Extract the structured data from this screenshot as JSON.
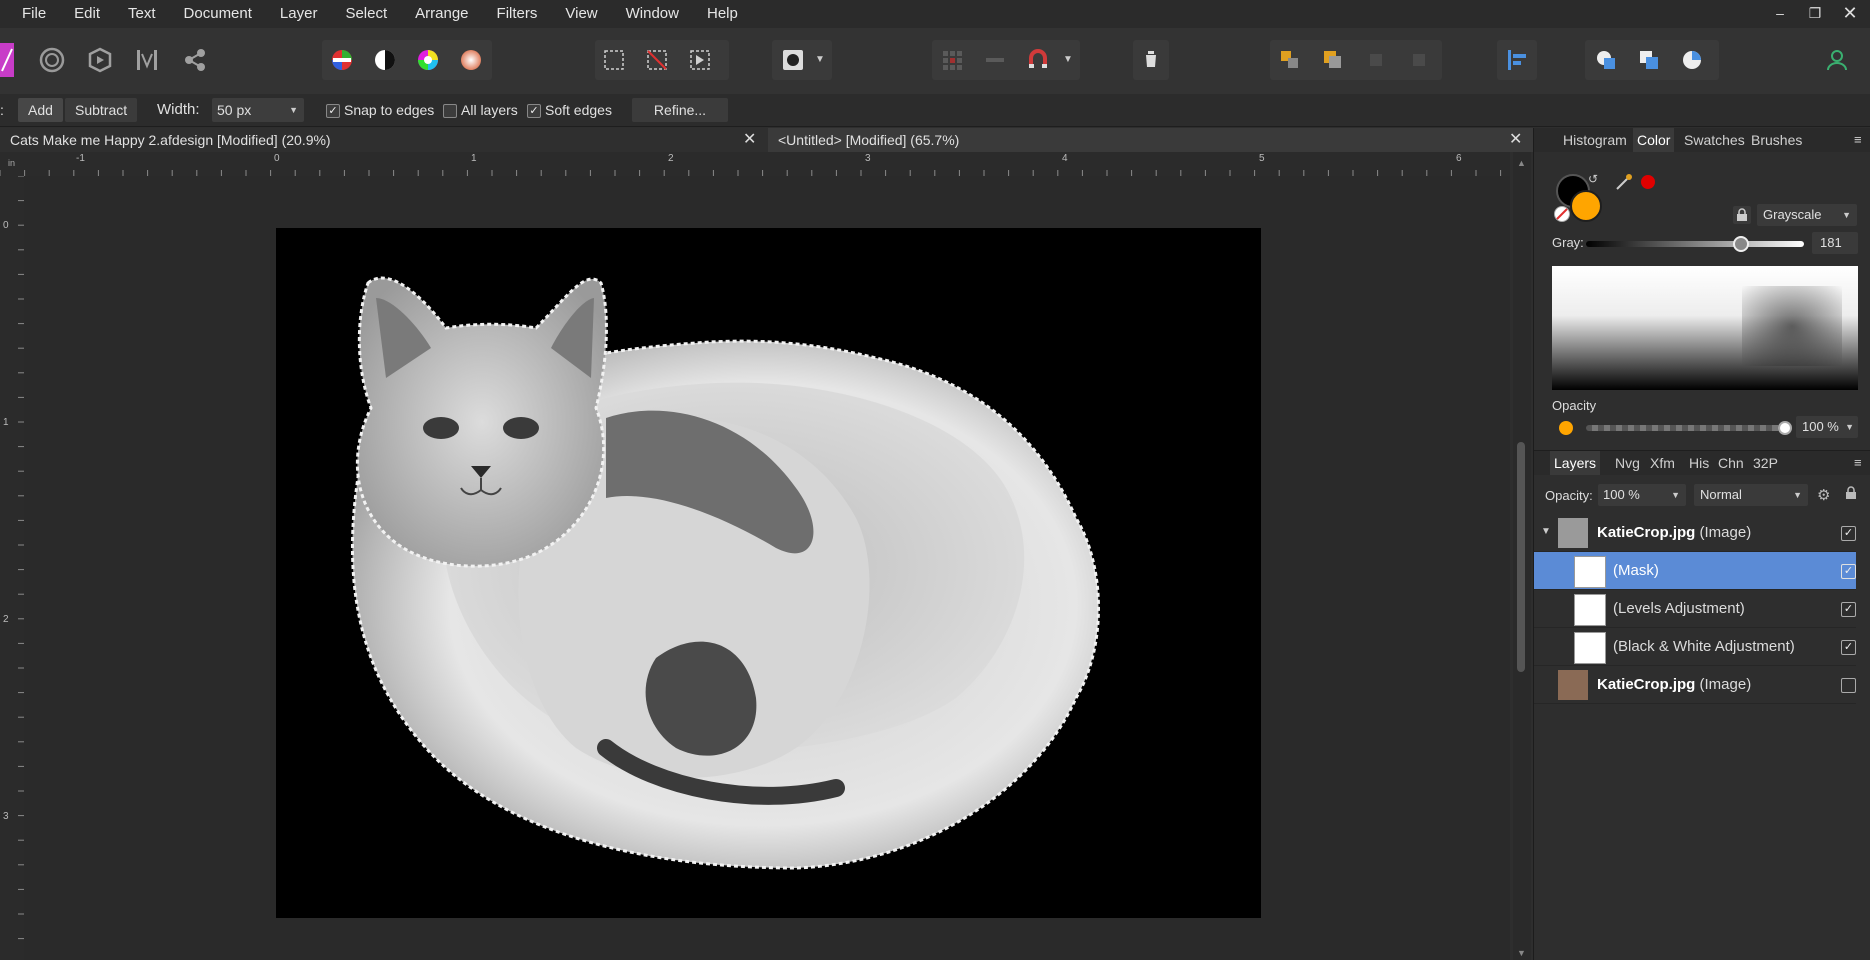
{
  "menu": [
    "File",
    "Edit",
    "Text",
    "Document",
    "Layer",
    "Select",
    "Arrange",
    "Filters",
    "View",
    "Window",
    "Help"
  ],
  "context_bar": {
    "leading": ":",
    "add_label": "Add",
    "subtract_label": "Subtract",
    "width_label": "Width:",
    "width_value": "50 px",
    "snap_label": "Snap to edges",
    "snap_checked": true,
    "all_layers_label": "All layers",
    "all_layers_checked": false,
    "soft_edges_label": "Soft edges",
    "soft_edges_checked": true,
    "refine_label": "Refine..."
  },
  "tabs": [
    {
      "title": "Cats Make me Happy 2.afdesign [Modified] (20.9%)"
    },
    {
      "title": "<Untitled> [Modified] (65.7%)"
    }
  ],
  "ruler": {
    "unit": "in",
    "h_ticks": [
      "-1",
      "0",
      "1",
      "2",
      "3",
      "4",
      "5",
      "6"
    ],
    "v_ticks": [
      "0",
      "1",
      "2",
      "3"
    ]
  },
  "color_panel": {
    "tabs": [
      "Histogram",
      "Color",
      "Swatches",
      "Brushes"
    ],
    "active_tab": "Color",
    "mode": "Grayscale",
    "gray_label": "Gray:",
    "gray_value": "181",
    "opacity_label": "Opacity",
    "opacity_value": "100 %",
    "fill_color": "#ffa500",
    "stroke_color": "#000000"
  },
  "layers_panel": {
    "tabs": [
      "Layers",
      "Nvg",
      "Xfm",
      "His",
      "Chn",
      "32P"
    ],
    "active_tab": "Layers",
    "opacity_label": "Opacity:",
    "opacity_value": "100 %",
    "blend_mode": "Normal",
    "layers": [
      {
        "name": "KatieCrop.jpg",
        "type": "(Image)",
        "visible": true,
        "selected": false
      },
      {
        "name": "",
        "type": "(Mask)",
        "visible": true,
        "selected": true
      },
      {
        "name": "",
        "type": "(Levels Adjustment)",
        "visible": true,
        "selected": false
      },
      {
        "name": "",
        "type": "(Black & White Adjustment)",
        "visible": true,
        "selected": false
      },
      {
        "name": "KatieCrop.jpg",
        "type": "(Image)",
        "visible": false,
        "selected": false
      }
    ]
  },
  "colors": {
    "accent": "#5b8bd6",
    "brand": "#cc44cc"
  }
}
